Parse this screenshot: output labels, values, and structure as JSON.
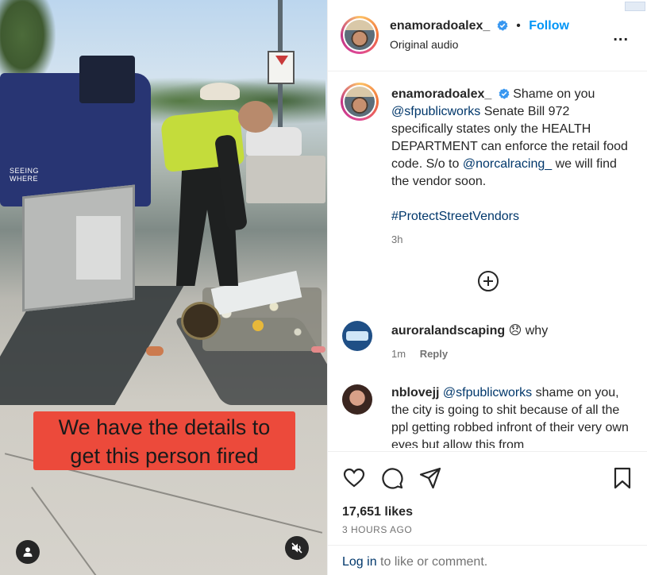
{
  "video": {
    "overlay_caption_line1": "We have the details to",
    "overlay_caption_line2": "get this person fired",
    "truck_text": "SEEING WHERE",
    "user_icon": "user-icon",
    "mute_icon": "muted-speaker-icon"
  },
  "post": {
    "author": "enamoradoalex_",
    "verified": true,
    "follow_label": "Follow",
    "audio_label": "Original audio",
    "more_label": "...",
    "caption": {
      "text_1": "Shame on you",
      "mention_1": "@sfpublicworks",
      "text_2": "Senate Bill 972 specifically states only the HEALTH DEPARTMENT can enforce the retail food code. S/o to",
      "mention_2": "@norcalracing_",
      "text_3": "we will find the vendor soon.",
      "hashtag": "#ProtectStreetVendors",
      "age": "3h"
    },
    "load_more_icon": "plus-circle-icon"
  },
  "comments": [
    {
      "username": "auroralandscaping",
      "emoji": "😞",
      "text": "why",
      "age": "1m",
      "reply_label": "Reply"
    },
    {
      "username": "nblovejj",
      "mention": "@sfpublicworks",
      "text": "shame on you, the city is going to shit because of all the ppl getting robbed infront of their very own eyes but allow this from"
    }
  ],
  "actions": {
    "like_icon": "heart-icon",
    "comment_icon": "comment-icon",
    "share_icon": "send-icon",
    "save_icon": "bookmark-icon"
  },
  "stats": {
    "likes": "17,651 likes",
    "posted": "3 HOURS AGO"
  },
  "footer": {
    "login_link": "Log in",
    "login_suffix": "to like or comment."
  },
  "colors": {
    "accent": "#0095f6",
    "link": "#00376b",
    "caption_bg": "#ec4a3b",
    "muted_text": "#737373"
  }
}
